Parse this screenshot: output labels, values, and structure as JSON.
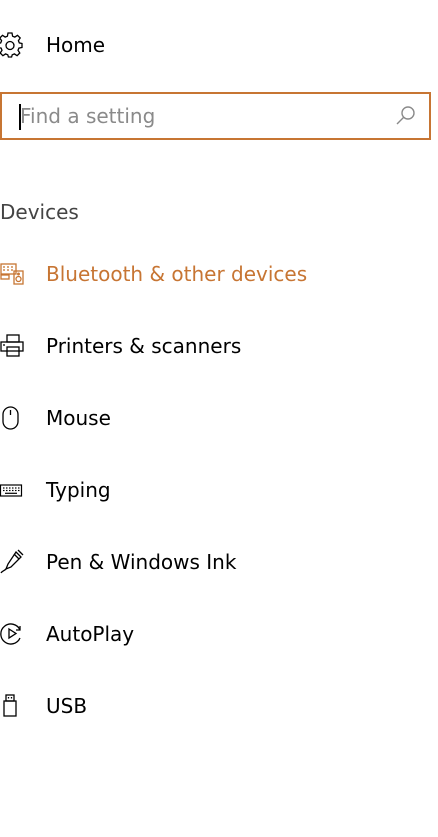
{
  "home": {
    "label": "Home",
    "icon": "gear-icon"
  },
  "search": {
    "placeholder": "Find a setting",
    "value": "",
    "icon": "search-icon"
  },
  "section": {
    "title": "Devices"
  },
  "accent_color": "#c77533",
  "nav": {
    "items": [
      {
        "label": "Bluetooth & other devices",
        "icon": "bluetooth-devices-icon",
        "selected": true
      },
      {
        "label": "Printers & scanners",
        "icon": "printer-icon",
        "selected": false
      },
      {
        "label": "Mouse",
        "icon": "mouse-icon",
        "selected": false
      },
      {
        "label": "Typing",
        "icon": "keyboard-icon",
        "selected": false
      },
      {
        "label": "Pen & Windows Ink",
        "icon": "pen-icon",
        "selected": false
      },
      {
        "label": "AutoPlay",
        "icon": "autoplay-icon",
        "selected": false
      },
      {
        "label": "USB",
        "icon": "usb-icon",
        "selected": false
      }
    ]
  }
}
